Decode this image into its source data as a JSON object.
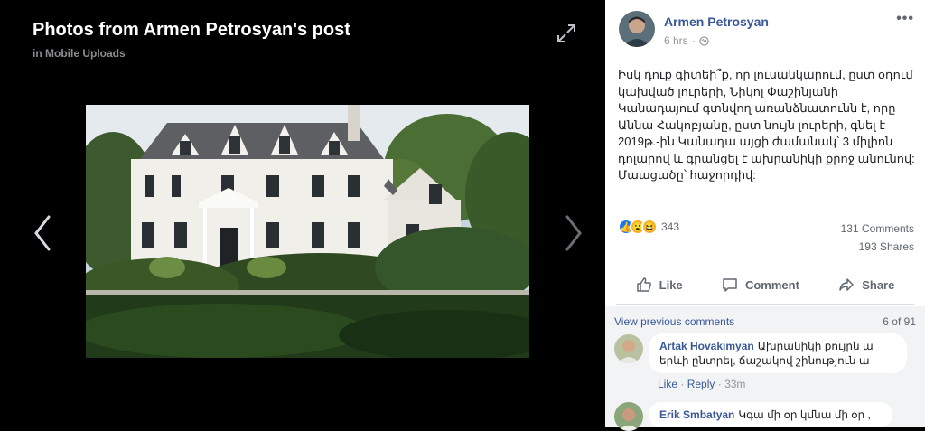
{
  "viewer": {
    "title": "Photos from Armen Petrosyan's post",
    "album": "in Mobile Uploads"
  },
  "post": {
    "author": "Armen Petrosyan",
    "time": "6 hrs",
    "text": "Իսկ դուք գիտեի՞ք, որ լուսանկարում, ըստ օդում կախված լուրերի, Նիկոլ Փաշինյանի Կանադայում գտնվող առանձնատունն է, որը Աննա Հակոբյանը, ըստ նույն լուրերի, գնել է 2019թ.-ին Կանադա այցի ժամանակ՝ 3 միլիոն դոլարով և գրանցել է ախրանիկի քրոջ անունով:\nՄաացածը՝ հաջորդիվ:",
    "reaction_count": "343",
    "comments_count": "131 Comments",
    "shares_count": "193 Shares"
  },
  "actions": {
    "like": "Like",
    "comment": "Comment",
    "share": "Share"
  },
  "comments": {
    "view_previous": "View previous comments",
    "count_of": "6 of 91",
    "items": [
      {
        "name": "Artak Hovakimyan",
        "text": "Ախրանիկի քույրն ա երևի ընտրել, ճաշակով շինություն ա",
        "like": "Like",
        "reply": "Reply",
        "time": "33m"
      },
      {
        "name": "Erik Smbatyan",
        "text": "Կգա մի օր կմնա մի օր ,"
      }
    ]
  },
  "colors": {
    "link": "#385898",
    "like_reaction": "#1877f2",
    "wow_reaction": "#f7b125",
    "haha_reaction": "#f7b125"
  }
}
